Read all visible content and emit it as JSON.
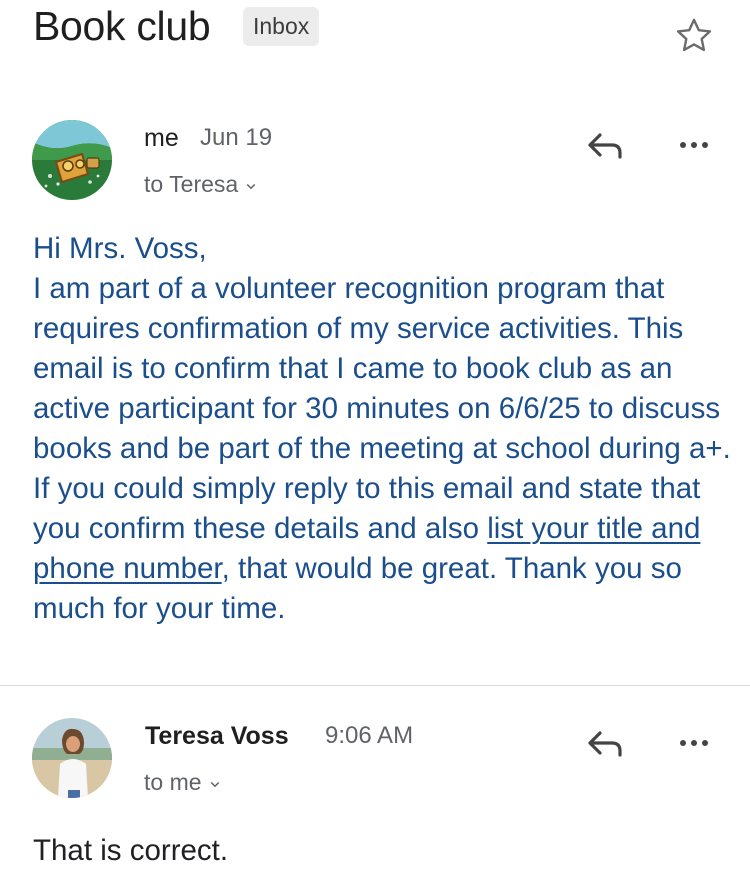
{
  "thread": {
    "subject": "Book club",
    "label": "Inbox"
  },
  "messages": [
    {
      "sender": "me",
      "time": "Jun 19",
      "recipients": "to Teresa",
      "body": {
        "greeting": "Hi Mrs. Voss,",
        "text_before_link": "I am part of a volunteer recognition program that requires confirmation of my service activities. This email is to confirm that I came to book club as an active participant for 30 minutes on 6/6/25 to discuss books and be part of the meeting at school during a+. If you could simply reply to this email and state that you confirm these details and also ",
        "link_text": "list your title and phone number",
        "text_after_link": ", that would be great. Thank you so much for your time."
      }
    },
    {
      "sender": "Teresa Voss",
      "time": "9:06 AM",
      "recipients": "to me",
      "body": {
        "text": "That is correct."
      }
    }
  ],
  "icons": {
    "star": "star-outline-icon",
    "reply": "reply-arrow-icon",
    "more": "more-horizontal-icon",
    "chevron": "chevron-down-icon"
  },
  "colors": {
    "body_text_blue": "#1a4e8c",
    "secondary_gray": "#5f6368"
  }
}
